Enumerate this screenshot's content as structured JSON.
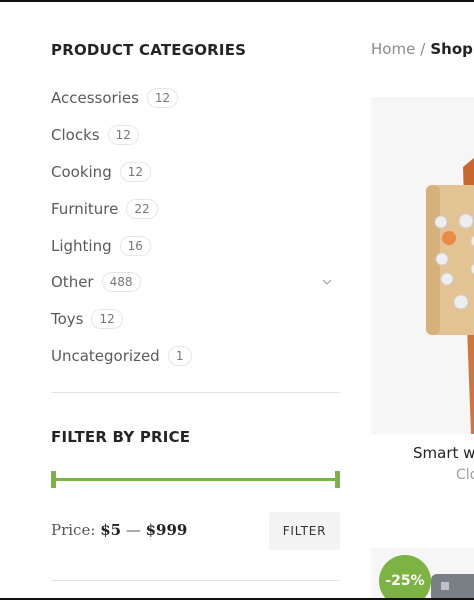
{
  "sidebar": {
    "categories_title": "PRODUCT CATEGORIES",
    "categories": [
      {
        "name": "Accessories",
        "count": "12"
      },
      {
        "name": "Clocks",
        "count": "12"
      },
      {
        "name": "Cooking",
        "count": "12"
      },
      {
        "name": "Furniture",
        "count": "22"
      },
      {
        "name": "Lighting",
        "count": "16"
      },
      {
        "name": "Other",
        "count": "488"
      },
      {
        "name": "Toys",
        "count": "12"
      },
      {
        "name": "Uncategorized",
        "count": "1"
      }
    ],
    "price_title": "FILTER BY PRICE",
    "price_label": "Price:",
    "price_min": "$5",
    "price_dash": " — ",
    "price_max": "$999",
    "filter_label": "FILTER",
    "accent_color": "#7cb342"
  },
  "breadcrumb": {
    "home": "Home",
    "separator": "/",
    "current": "Shop"
  },
  "products": [
    {
      "title": "Smart w",
      "category": "Clo"
    },
    {
      "badge": "-25%"
    }
  ]
}
